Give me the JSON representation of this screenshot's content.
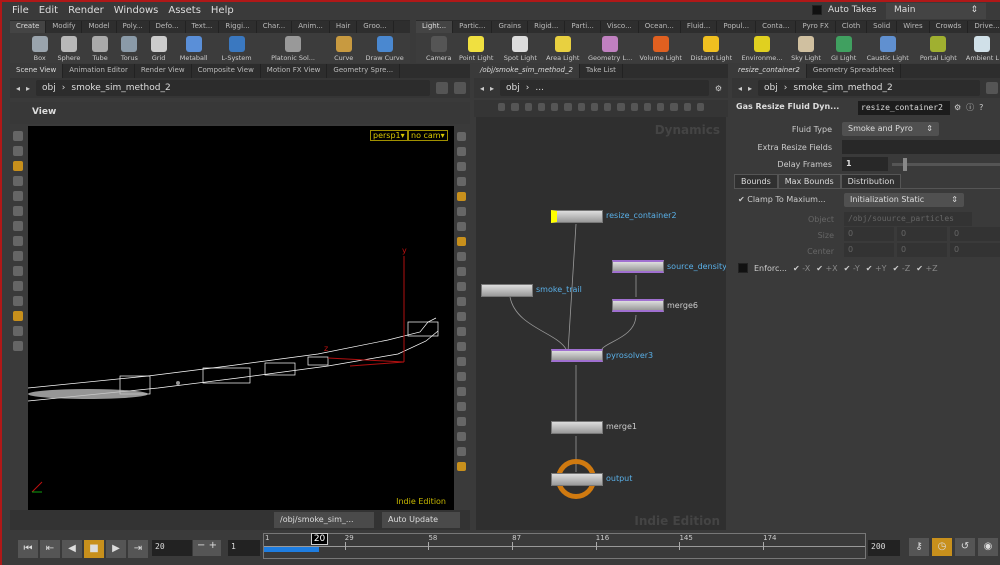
{
  "menu": [
    "File",
    "Edit",
    "Render",
    "Windows",
    "Assets",
    "Help"
  ],
  "auto_takes": "Auto Takes",
  "take": "Main",
  "shelf_left": {
    "tabs": [
      "Create",
      "Modify",
      "Model",
      "Poly...",
      "Defo...",
      "Text...",
      "Riggi...",
      "Char...",
      "Anim...",
      "Hair",
      "Groo..."
    ],
    "tools": [
      {
        "label": "Box",
        "color": "#9aa4ad"
      },
      {
        "label": "Sphere",
        "color": "#b8b8b8"
      },
      {
        "label": "Tube",
        "color": "#aaaaaa"
      },
      {
        "label": "Torus",
        "color": "#8a9aa8"
      },
      {
        "label": "Grid",
        "color": "#cccccc"
      },
      {
        "label": "Metaball",
        "color": "#5a8fd8"
      },
      {
        "label": "L-System",
        "color": "#3a78c0"
      },
      {
        "label": "Platonic Sol...",
        "color": "#999999"
      },
      {
        "label": "Curve",
        "color": "#c89a40"
      },
      {
        "label": "Draw Curve",
        "color": "#4a88d0"
      }
    ]
  },
  "shelf_right": {
    "tabs": [
      "Light...",
      "Partic...",
      "Grains",
      "Rigid...",
      "Parti...",
      "Visco...",
      "Ocean...",
      "Fluid...",
      "Popul...",
      "Conta...",
      "Pyro FX",
      "Cloth",
      "Solid",
      "Wires",
      "Crowds",
      "Drive..."
    ],
    "tools": [
      {
        "label": "Camera",
        "color": "#555555"
      },
      {
        "label": "Point Light",
        "color": "#f0e040"
      },
      {
        "label": "Spot Light",
        "color": "#dddddd"
      },
      {
        "label": "Area Light",
        "color": "#e8d040"
      },
      {
        "label": "Geometry L...",
        "color": "#c080c0"
      },
      {
        "label": "Volume Light",
        "color": "#e06020"
      },
      {
        "label": "Distant Light",
        "color": "#f0c020"
      },
      {
        "label": "Environme...",
        "color": "#e0d020"
      },
      {
        "label": "Sky Light",
        "color": "#d0c0a0"
      },
      {
        "label": "GI Light",
        "color": "#40a060"
      },
      {
        "label": "Caustic Light",
        "color": "#6090d0"
      },
      {
        "label": "Portal Light",
        "color": "#a0b030"
      },
      {
        "label": "Ambient L",
        "color": "#d0e0e8"
      }
    ]
  },
  "left_tabs": [
    "Scene View",
    "Animation Editor",
    "Render View",
    "Composite View",
    "Motion FX View",
    "Geometry Spre..."
  ],
  "mid_tabs": [
    "/obj/smoke_sim_method_2",
    "Take List"
  ],
  "right_tabs": [
    "resize_container2",
    "Geometry Spreadsheet"
  ],
  "path": {
    "root": "obj",
    "node": "smoke_sim_method_2",
    "mid_node": "..."
  },
  "viewport": {
    "title": "View",
    "camera": "persp1",
    "cam_menu": "no cam",
    "watermark": "Indie Edition",
    "axis_y": "y",
    "axis_z": "z",
    "bottom_path": "/obj/smoke_sim_...",
    "update_mode": "Auto Update"
  },
  "network": {
    "context": "Dynamics",
    "watermark": "Indie Edition",
    "nodes": [
      {
        "name": "resize_container2"
      },
      {
        "name": "source_density_"
      },
      {
        "name": "smoke_trail"
      },
      {
        "name": "merge6"
      },
      {
        "name": "pyrosolver3"
      },
      {
        "name": "merge1"
      },
      {
        "name": "output"
      }
    ]
  },
  "params": {
    "type": "Gas Resize Fluid Dyn...",
    "name": "resize_container2",
    "fluid_type_label": "Fluid Type",
    "fluid_type": "Smoke and Pyro",
    "extra_label": "Extra Resize Fields",
    "extra": "",
    "delay_label": "Delay Frames",
    "delay": "1",
    "delay_slider": 0.1,
    "tabs": [
      "Bounds",
      "Max Bounds",
      "Distribution"
    ],
    "clamp_label": "Clamp To Maxium...",
    "clamp_checked": true,
    "clamp_mode": "Initialization Static",
    "object_label": "Object",
    "object": "/obj/souurce_particles",
    "size_label": "Size",
    "size": [
      "0",
      "0",
      "0"
    ],
    "center_label": "Center",
    "center": [
      "0",
      "0",
      "0"
    ],
    "enforce_label": "Enforc...",
    "enforce_checked": false,
    "axes": [
      "-X",
      "+X",
      "-Y",
      "+Y",
      "-Z",
      "+Z"
    ]
  },
  "timeline": {
    "frame": "20",
    "step": "1",
    "start": "1",
    "current": "20",
    "end": "200",
    "ticks": [
      "29",
      "58",
      "87",
      "116",
      "145",
      "174"
    ],
    "playing": false,
    "accent": "#c8901c"
  }
}
